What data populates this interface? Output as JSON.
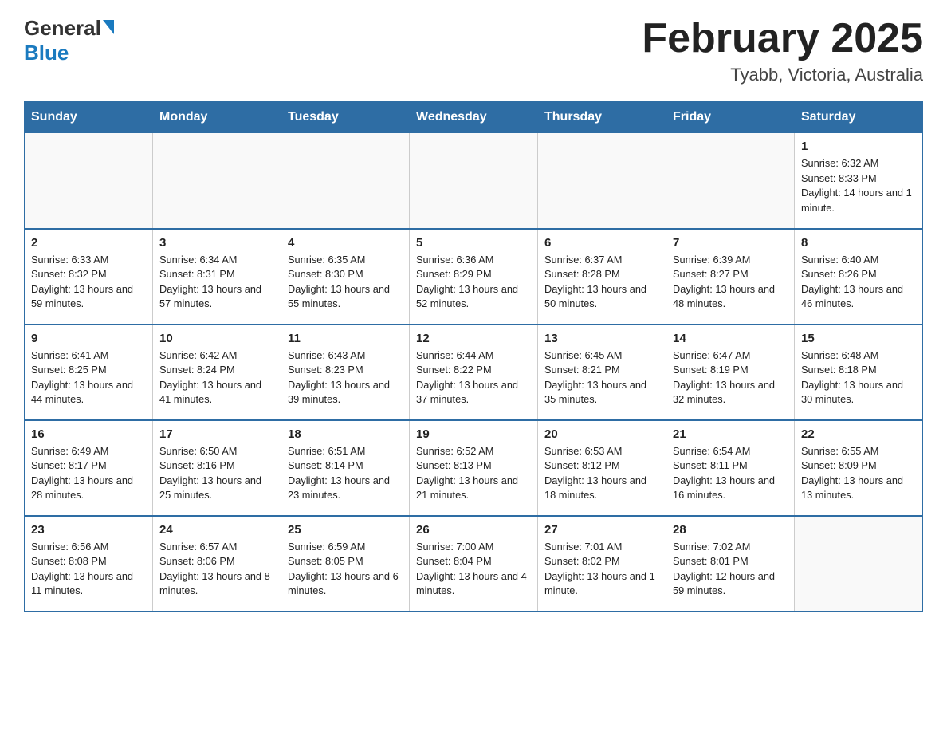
{
  "header": {
    "logo_general": "General",
    "logo_blue": "Blue",
    "title": "February 2025",
    "subtitle": "Tyabb, Victoria, Australia"
  },
  "days_of_week": [
    "Sunday",
    "Monday",
    "Tuesday",
    "Wednesday",
    "Thursday",
    "Friday",
    "Saturday"
  ],
  "weeks": [
    [
      {
        "day": "",
        "info": ""
      },
      {
        "day": "",
        "info": ""
      },
      {
        "day": "",
        "info": ""
      },
      {
        "day": "",
        "info": ""
      },
      {
        "day": "",
        "info": ""
      },
      {
        "day": "",
        "info": ""
      },
      {
        "day": "1",
        "info": "Sunrise: 6:32 AM\nSunset: 8:33 PM\nDaylight: 14 hours and 1 minute."
      }
    ],
    [
      {
        "day": "2",
        "info": "Sunrise: 6:33 AM\nSunset: 8:32 PM\nDaylight: 13 hours and 59 minutes."
      },
      {
        "day": "3",
        "info": "Sunrise: 6:34 AM\nSunset: 8:31 PM\nDaylight: 13 hours and 57 minutes."
      },
      {
        "day": "4",
        "info": "Sunrise: 6:35 AM\nSunset: 8:30 PM\nDaylight: 13 hours and 55 minutes."
      },
      {
        "day": "5",
        "info": "Sunrise: 6:36 AM\nSunset: 8:29 PM\nDaylight: 13 hours and 52 minutes."
      },
      {
        "day": "6",
        "info": "Sunrise: 6:37 AM\nSunset: 8:28 PM\nDaylight: 13 hours and 50 minutes."
      },
      {
        "day": "7",
        "info": "Sunrise: 6:39 AM\nSunset: 8:27 PM\nDaylight: 13 hours and 48 minutes."
      },
      {
        "day": "8",
        "info": "Sunrise: 6:40 AM\nSunset: 8:26 PM\nDaylight: 13 hours and 46 minutes."
      }
    ],
    [
      {
        "day": "9",
        "info": "Sunrise: 6:41 AM\nSunset: 8:25 PM\nDaylight: 13 hours and 44 minutes."
      },
      {
        "day": "10",
        "info": "Sunrise: 6:42 AM\nSunset: 8:24 PM\nDaylight: 13 hours and 41 minutes."
      },
      {
        "day": "11",
        "info": "Sunrise: 6:43 AM\nSunset: 8:23 PM\nDaylight: 13 hours and 39 minutes."
      },
      {
        "day": "12",
        "info": "Sunrise: 6:44 AM\nSunset: 8:22 PM\nDaylight: 13 hours and 37 minutes."
      },
      {
        "day": "13",
        "info": "Sunrise: 6:45 AM\nSunset: 8:21 PM\nDaylight: 13 hours and 35 minutes."
      },
      {
        "day": "14",
        "info": "Sunrise: 6:47 AM\nSunset: 8:19 PM\nDaylight: 13 hours and 32 minutes."
      },
      {
        "day": "15",
        "info": "Sunrise: 6:48 AM\nSunset: 8:18 PM\nDaylight: 13 hours and 30 minutes."
      }
    ],
    [
      {
        "day": "16",
        "info": "Sunrise: 6:49 AM\nSunset: 8:17 PM\nDaylight: 13 hours and 28 minutes."
      },
      {
        "day": "17",
        "info": "Sunrise: 6:50 AM\nSunset: 8:16 PM\nDaylight: 13 hours and 25 minutes."
      },
      {
        "day": "18",
        "info": "Sunrise: 6:51 AM\nSunset: 8:14 PM\nDaylight: 13 hours and 23 minutes."
      },
      {
        "day": "19",
        "info": "Sunrise: 6:52 AM\nSunset: 8:13 PM\nDaylight: 13 hours and 21 minutes."
      },
      {
        "day": "20",
        "info": "Sunrise: 6:53 AM\nSunset: 8:12 PM\nDaylight: 13 hours and 18 minutes."
      },
      {
        "day": "21",
        "info": "Sunrise: 6:54 AM\nSunset: 8:11 PM\nDaylight: 13 hours and 16 minutes."
      },
      {
        "day": "22",
        "info": "Sunrise: 6:55 AM\nSunset: 8:09 PM\nDaylight: 13 hours and 13 minutes."
      }
    ],
    [
      {
        "day": "23",
        "info": "Sunrise: 6:56 AM\nSunset: 8:08 PM\nDaylight: 13 hours and 11 minutes."
      },
      {
        "day": "24",
        "info": "Sunrise: 6:57 AM\nSunset: 8:06 PM\nDaylight: 13 hours and 8 minutes."
      },
      {
        "day": "25",
        "info": "Sunrise: 6:59 AM\nSunset: 8:05 PM\nDaylight: 13 hours and 6 minutes."
      },
      {
        "day": "26",
        "info": "Sunrise: 7:00 AM\nSunset: 8:04 PM\nDaylight: 13 hours and 4 minutes."
      },
      {
        "day": "27",
        "info": "Sunrise: 7:01 AM\nSunset: 8:02 PM\nDaylight: 13 hours and 1 minute."
      },
      {
        "day": "28",
        "info": "Sunrise: 7:02 AM\nSunset: 8:01 PM\nDaylight: 12 hours and 59 minutes."
      },
      {
        "day": "",
        "info": ""
      }
    ]
  ]
}
